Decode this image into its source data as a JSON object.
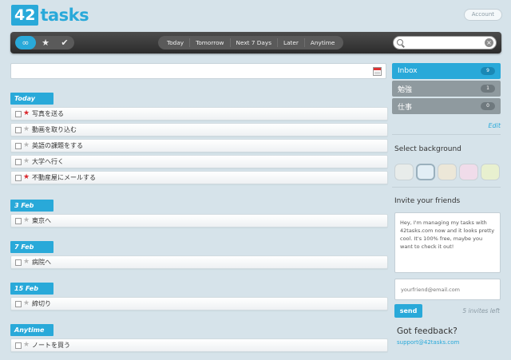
{
  "header": {
    "logo_number": "42",
    "logo_word": "tasks",
    "account_label": "Account"
  },
  "toolbar": {
    "filters": [
      {
        "icon": "infinity-icon",
        "glyph": "∞",
        "active": true
      },
      {
        "icon": "star-icon",
        "glyph": "★",
        "active": false
      },
      {
        "icon": "checkmark-icon",
        "glyph": "✔",
        "active": false
      }
    ],
    "views": [
      "Today",
      "Tomorrow",
      "Next 7 Days",
      "Later",
      "Anytime"
    ],
    "search_placeholder": ""
  },
  "add_task": {
    "placeholder": ""
  },
  "groups": [
    {
      "label": "Today",
      "tasks": [
        {
          "text": "写真を送る",
          "starred": true
        },
        {
          "text": "動画を取り込む",
          "starred": false
        },
        {
          "text": "英語の課題をする",
          "starred": false
        },
        {
          "text": "大学へ行く",
          "starred": false
        },
        {
          "text": "不動産屋にメールする",
          "starred": true
        }
      ]
    },
    {
      "label": "3 Feb",
      "tasks": [
        {
          "text": "東京へ",
          "starred": false
        }
      ]
    },
    {
      "label": "7 Feb",
      "tasks": [
        {
          "text": "病院へ",
          "starred": false
        }
      ]
    },
    {
      "label": "15 Feb",
      "tasks": [
        {
          "text": "締切り",
          "starred": false
        }
      ]
    },
    {
      "label": "Anytime",
      "tasks": [
        {
          "text": "ノートを買う",
          "starred": false
        }
      ]
    }
  ],
  "sidebar": {
    "lists": [
      {
        "name": "Inbox",
        "count": "9",
        "active": true
      },
      {
        "name": "勉強",
        "count": "1",
        "active": false
      },
      {
        "name": "仕事",
        "count": "0",
        "active": false
      }
    ],
    "edit_label": "Edit",
    "background_heading": "Select background",
    "background_colors": [
      "#e8ecea",
      "#e2eef5",
      "#ece7d8",
      "#f0dcea",
      "#e8f0cf"
    ],
    "invite_heading": "Invite your friends",
    "invite_message": "Hey, I'm managing my tasks with 42tasks.com now and it looks pretty cool. It's 100% free, maybe you want to check it out!",
    "email_placeholder": "yourfriend@email.com",
    "send_label": "send",
    "invites_left": "5 invites left",
    "feedback_heading": "Got feedback?",
    "feedback_link": "support@42tasks.com"
  },
  "colors": {
    "accent": "#29a9d9",
    "background": "#d6e3ea",
    "star_active": "#d9262c",
    "toolbar": "#3a3a3a"
  }
}
